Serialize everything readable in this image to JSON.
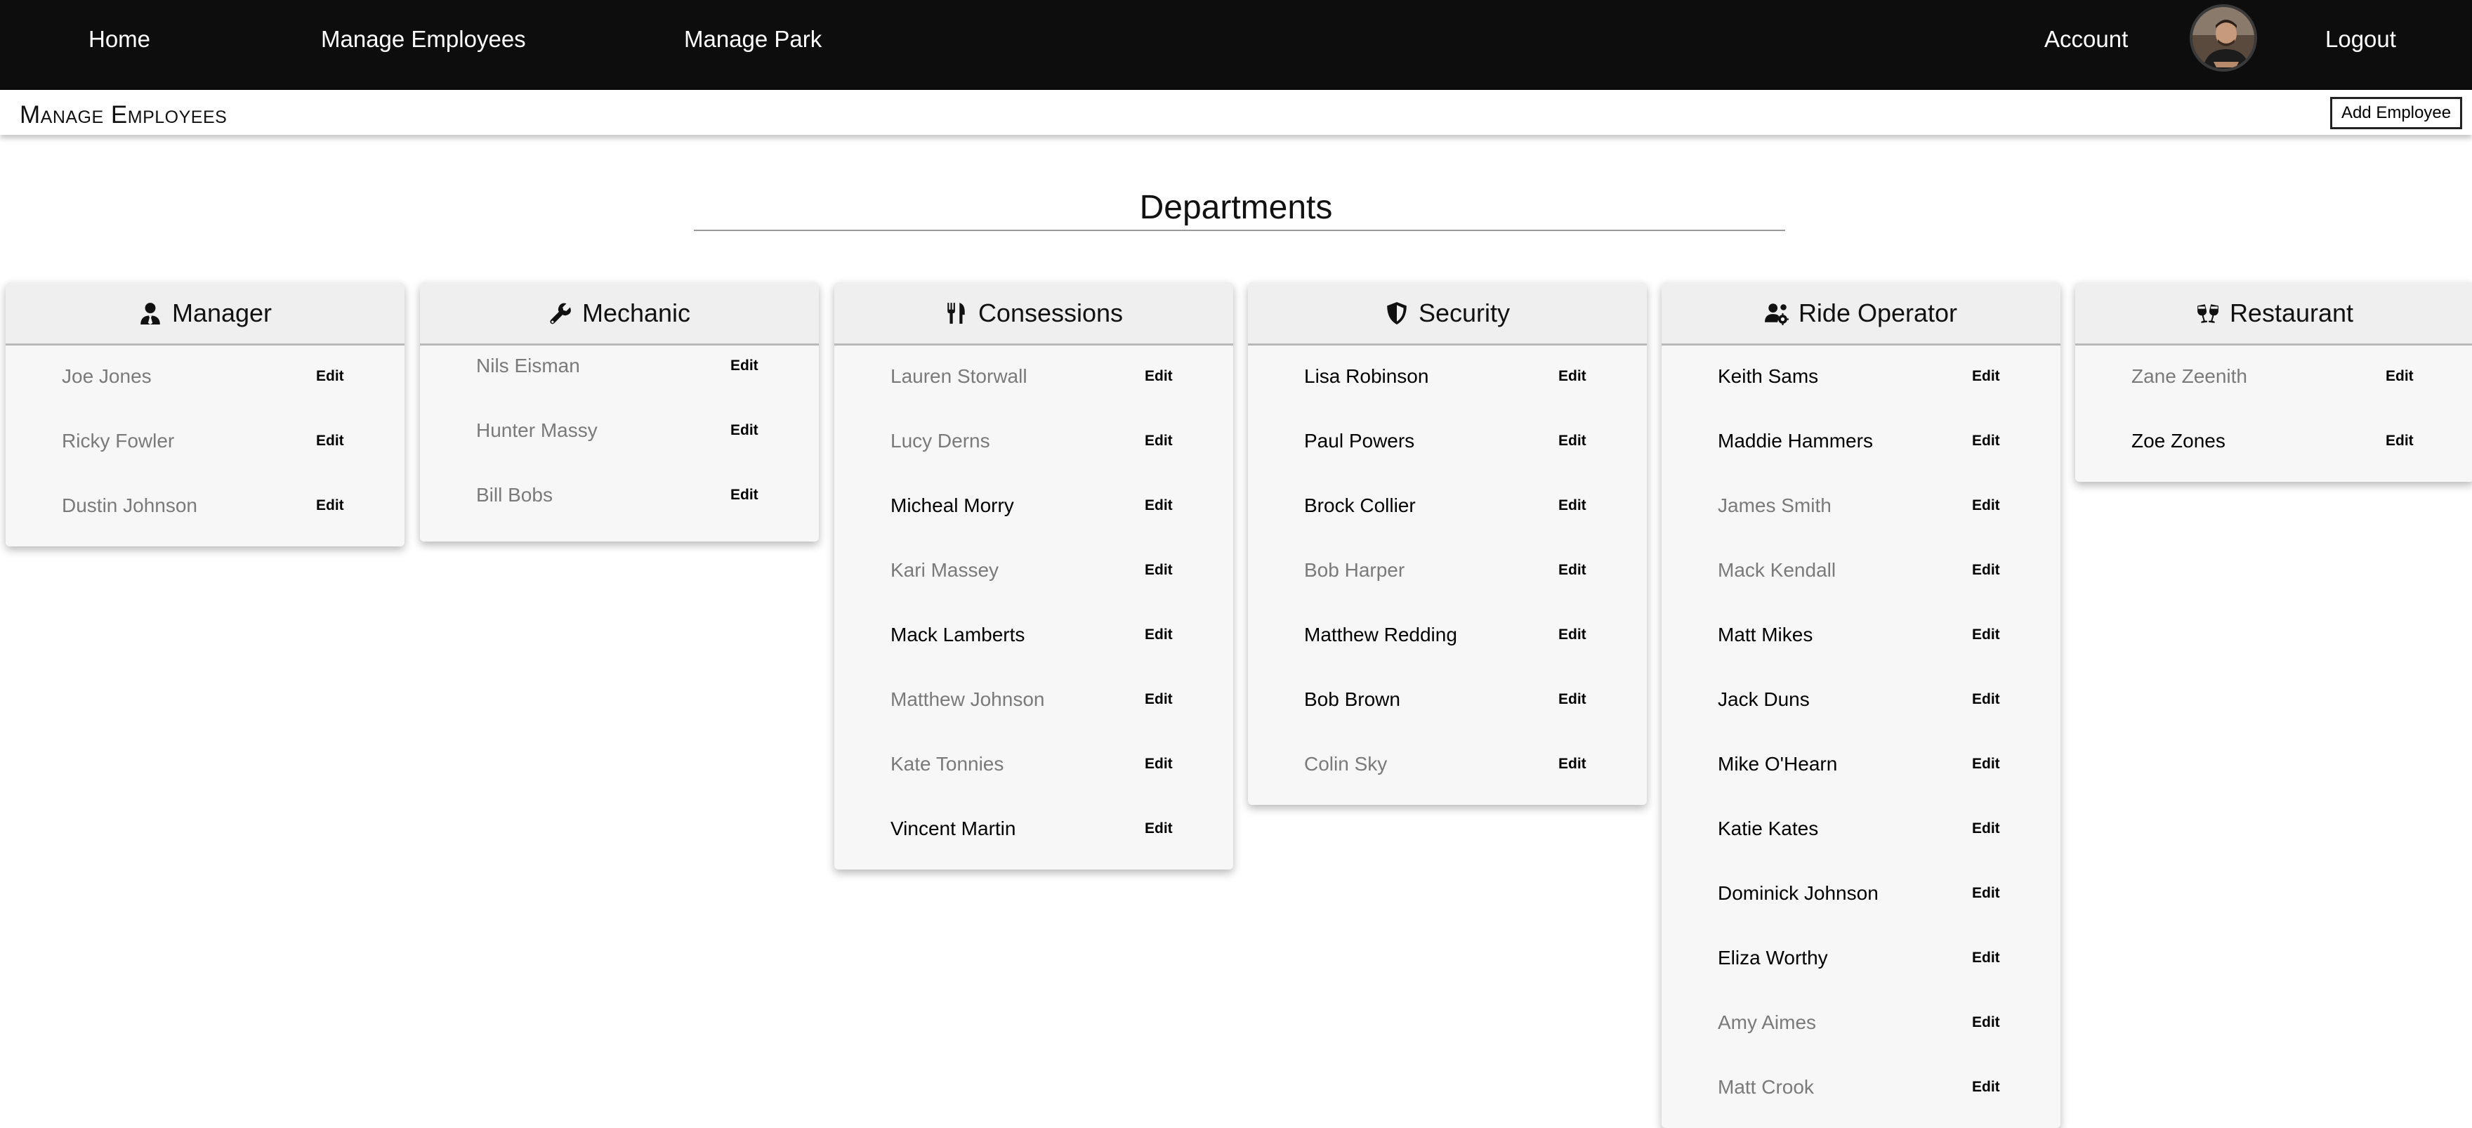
{
  "nav": {
    "home": "Home",
    "manage_employees": "Manage Employees",
    "manage_park": "Manage Park",
    "account": "Account",
    "logout": "Logout"
  },
  "page": {
    "title": "Manage Employees",
    "add_button": "Add Employee",
    "departments_heading": "Departments",
    "edit_label": "Edit"
  },
  "departments": [
    {
      "name": "Manager",
      "icon": "user-tie-icon",
      "employees": [
        {
          "name": "Joe Jones",
          "active": false
        },
        {
          "name": "Ricky Fowler",
          "active": false
        },
        {
          "name": "Dustin Johnson",
          "active": false
        }
      ]
    },
    {
      "name": "Mechanic",
      "icon": "wrench-icon",
      "employees": [
        {
          "name": "Nils Eisman",
          "active": false
        },
        {
          "name": "Hunter Massy",
          "active": false
        },
        {
          "name": "Bill Bobs",
          "active": false
        }
      ]
    },
    {
      "name": "Consessions",
      "icon": "utensils-icon",
      "employees": [
        {
          "name": "Lauren Storwall",
          "active": false
        },
        {
          "name": "Lucy Derns",
          "active": false
        },
        {
          "name": "Micheal Morry",
          "active": true
        },
        {
          "name": "Kari Massey",
          "active": false
        },
        {
          "name": "Mack Lamberts",
          "active": true
        },
        {
          "name": "Matthew Johnson",
          "active": false
        },
        {
          "name": "Kate Tonnies",
          "active": false
        },
        {
          "name": "Vincent Martin",
          "active": true
        }
      ]
    },
    {
      "name": "Security",
      "icon": "shield-icon",
      "employees": [
        {
          "name": "Lisa Robinson",
          "active": true
        },
        {
          "name": "Paul Powers",
          "active": true
        },
        {
          "name": "Brock Collier",
          "active": true
        },
        {
          "name": "Bob Harper",
          "active": false
        },
        {
          "name": "Matthew Redding",
          "active": true
        },
        {
          "name": "Bob Brown",
          "active": true
        },
        {
          "name": "Colin Sky",
          "active": false
        }
      ]
    },
    {
      "name": "Ride Operator",
      "icon": "users-cog-icon",
      "employees": [
        {
          "name": "Keith Sams",
          "active": true
        },
        {
          "name": "Maddie Hammers",
          "active": true
        },
        {
          "name": "James Smith",
          "active": false
        },
        {
          "name": "Mack Kendall",
          "active": false
        },
        {
          "name": "Matt Mikes",
          "active": true
        },
        {
          "name": "Jack Duns",
          "active": true
        },
        {
          "name": "Mike O'Hearn",
          "active": true
        },
        {
          "name": "Katie Kates",
          "active": true
        },
        {
          "name": "Dominick Johnson",
          "active": true
        },
        {
          "name": "Eliza Worthy",
          "active": true
        },
        {
          "name": "Amy Aimes",
          "active": false
        },
        {
          "name": "Matt Crook",
          "active": false
        }
      ]
    },
    {
      "name": "Restaurant",
      "icon": "wine-glasses-icon",
      "employees": [
        {
          "name": "Zane Zeenith",
          "active": false
        },
        {
          "name": "Zoe Zones",
          "active": true
        }
      ]
    }
  ],
  "colors": {
    "nav_bg": "#0d0d0d",
    "active_text": "#000000",
    "inactive_text": "#7a7a7a",
    "card_bg": "#f7f7f7",
    "card_header_bg": "#efefef"
  }
}
